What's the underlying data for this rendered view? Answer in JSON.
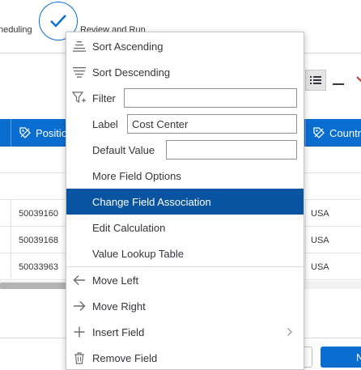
{
  "wizard": {
    "prev_step_label": "neduling",
    "current_step_label": "Review and Run"
  },
  "grid": {
    "headers": [
      "Positio",
      "Countr"
    ],
    "rows": [
      {
        "position": "50039160",
        "country": "USA"
      },
      {
        "position": "50039168",
        "country": "USA"
      },
      {
        "position": "50033963",
        "country": "USA"
      }
    ]
  },
  "footer": {
    "next_label": "N"
  },
  "menu": {
    "items": [
      {
        "label": "Sort Ascending",
        "icon": "sort-ascending-icon"
      },
      {
        "label": "Sort Descending",
        "icon": "sort-descending-icon"
      },
      {
        "label": "Filter",
        "icon": "filter-icon",
        "value": ""
      },
      {
        "label": "Label",
        "value": "Cost Center"
      },
      {
        "label": "Default Value",
        "value": ""
      },
      {
        "label": "More Field Options"
      },
      {
        "label": "Change Field Association",
        "selected": true
      },
      {
        "label": "Edit Calculation"
      },
      {
        "label": "Value Lookup Table"
      },
      {
        "label": "Move Left",
        "icon": "arrow-left-icon"
      },
      {
        "label": "Move Right",
        "icon": "arrow-right-icon"
      },
      {
        "label": "Insert Field",
        "icon": "plus-icon",
        "submenu": true
      },
      {
        "label": "Remove Field",
        "icon": "trash-icon"
      }
    ]
  },
  "colors": {
    "accent": "#0a6ed1",
    "selected_item": "#0854a0",
    "header_bg": "#0a6ed1"
  }
}
